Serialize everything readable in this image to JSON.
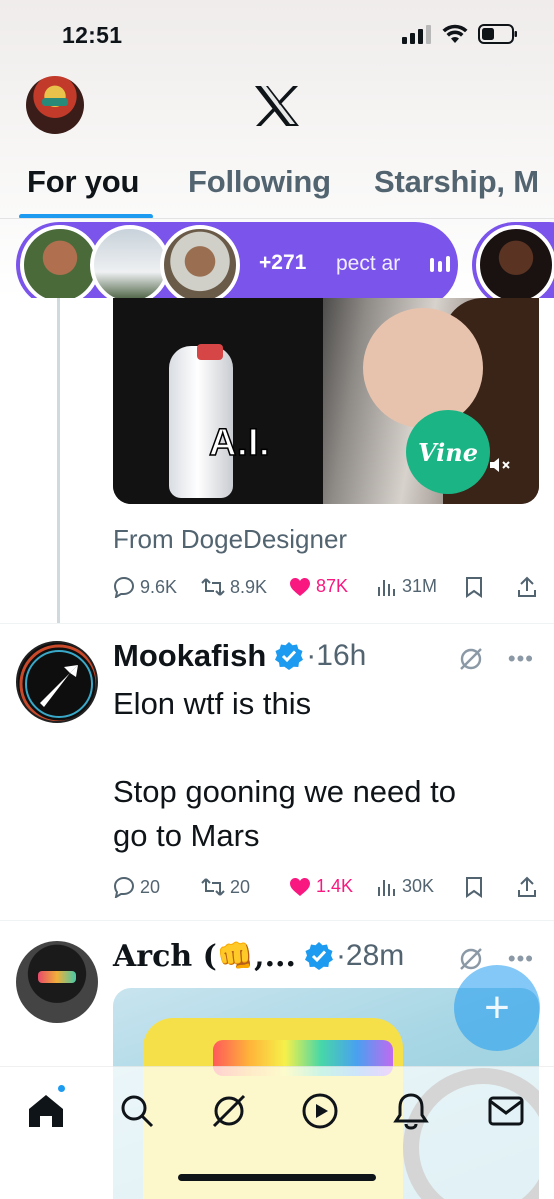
{
  "status_bar": {
    "time": "12:51"
  },
  "tabs": [
    {
      "label": "For you"
    },
    {
      "label": "Following"
    },
    {
      "label": "Starship, M"
    }
  ],
  "spaces": {
    "listener_count": "+271",
    "title_snippet": "pect ar"
  },
  "post1": {
    "media_overlay": "A.I.",
    "media_badge": "Vine",
    "from": "From DogeDesigner",
    "replies": "9.6K",
    "reposts": "8.9K",
    "likes": "87K",
    "views": "31M"
  },
  "post2": {
    "name": "Mookafish",
    "time": "·16h",
    "text_line1": "Elon wtf is this",
    "text_line2": "Stop gooning we need to",
    "text_line3": "go to Mars",
    "replies": "20",
    "reposts": "20",
    "likes": "1.4K",
    "views": "30K"
  },
  "post3": {
    "name": "Arch (👊,...",
    "time": "·28m"
  },
  "fab": {
    "label": "+"
  },
  "colors": {
    "accent": "#1d9bf0",
    "spaces_purple": "#7b54ec",
    "like_pink": "#f91880",
    "vine_green": "#1bb585"
  }
}
